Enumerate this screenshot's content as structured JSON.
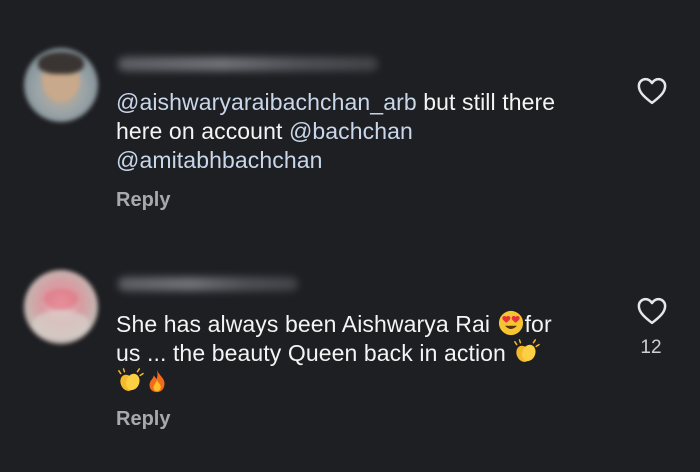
{
  "comments": [
    {
      "mention_1": "@aishwaryaraibachchan_arb",
      "text_1": "  but still there",
      "text_2": "here on account ",
      "mention_2": "@bachchan",
      "mention_3": "@amitabhbachchan",
      "reply_label": "Reply",
      "heart_icon": "heart-outline-icon"
    },
    {
      "text_1": "She has always been Aishwarya Rai ",
      "text_2": "for",
      "text_3": "us ... the beauty Queen back in action ",
      "reply_label": "Reply",
      "like_count": "12",
      "heart_icon": "heart-outline-icon",
      "emojis": [
        "heart-eyes-emoji",
        "clapping-hands-emoji",
        "clapping-hands-emoji",
        "fire-emoji"
      ]
    }
  ],
  "colors": {
    "background": "#1e1f23",
    "mention": "#c9d7ea",
    "text": "#f4f4f4",
    "muted": "#a8a9ad"
  }
}
